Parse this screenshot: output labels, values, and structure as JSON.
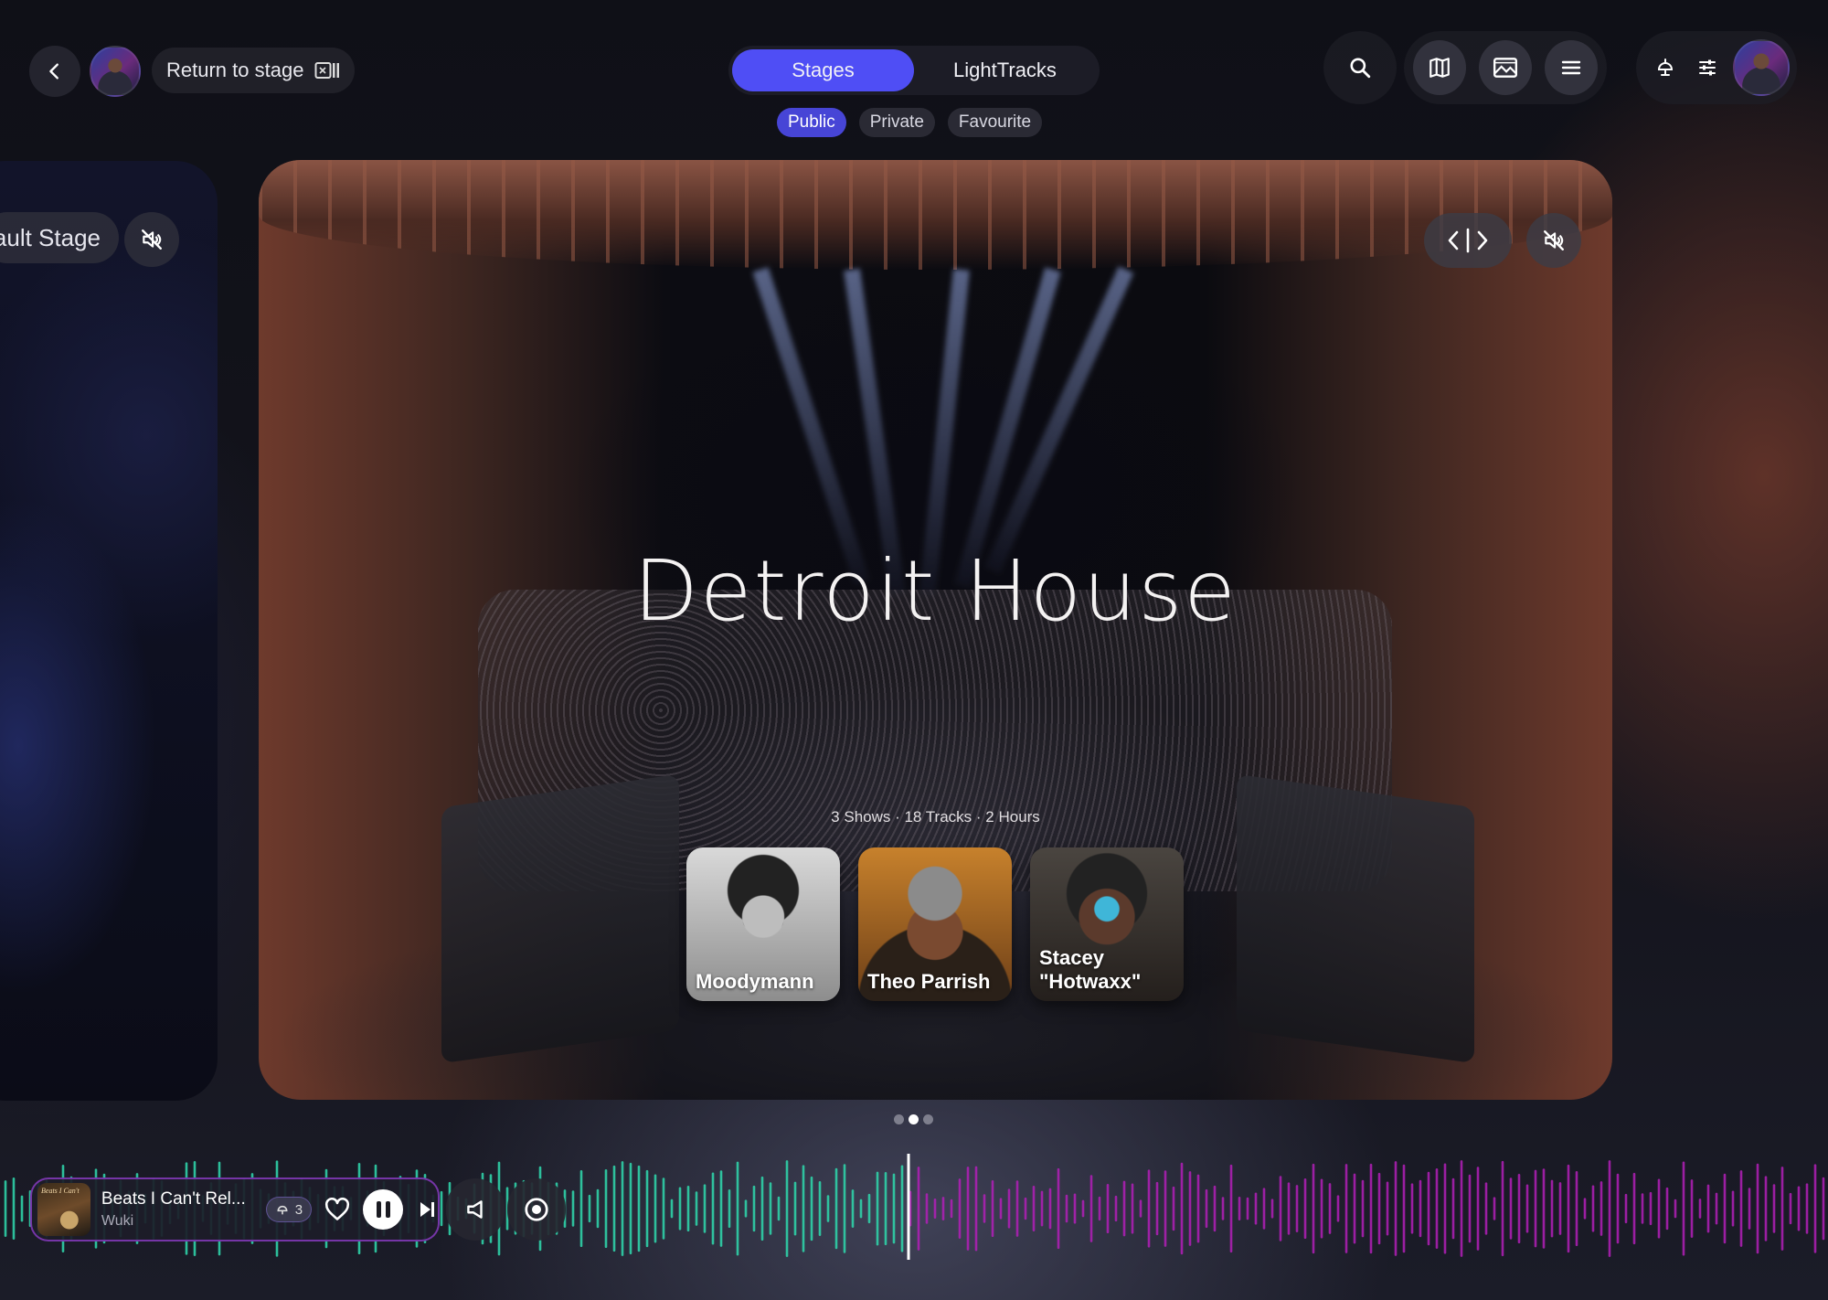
{
  "header": {
    "return_label": "Return to stage",
    "nav_tabs": [
      {
        "label": "Stages",
        "active": true
      },
      {
        "label": "LightTracks",
        "active": false
      }
    ],
    "filters": [
      {
        "label": "Public",
        "active": true
      },
      {
        "label": "Private",
        "active": false
      },
      {
        "label": "Favourite",
        "active": false
      }
    ],
    "icons": [
      "search-icon",
      "map-icon",
      "gallery-icon",
      "menu-icon",
      "lamp-icon",
      "sliders-icon"
    ],
    "accent": "#4f4ef5"
  },
  "left_card": {
    "label": "ault Stage"
  },
  "main_card": {
    "title": "Detroit House",
    "meta": "3 Shows  · 18 Tracks  · 2 Hours",
    "artists": [
      {
        "name": "Moodymann"
      },
      {
        "name": "Theo Parrish"
      },
      {
        "name": "Stacey \"Hotwaxx\""
      }
    ]
  },
  "pagination": {
    "count": 3,
    "active_index": 1
  },
  "player": {
    "album_text": "Beats I Can't",
    "track_title": "Beats I Can't Rel...",
    "artist": "Wuki",
    "boost_count": "3",
    "playhead_fraction": 0.497,
    "played_color": "#2fd1a8",
    "unplayed_color": "#b21fb8"
  }
}
